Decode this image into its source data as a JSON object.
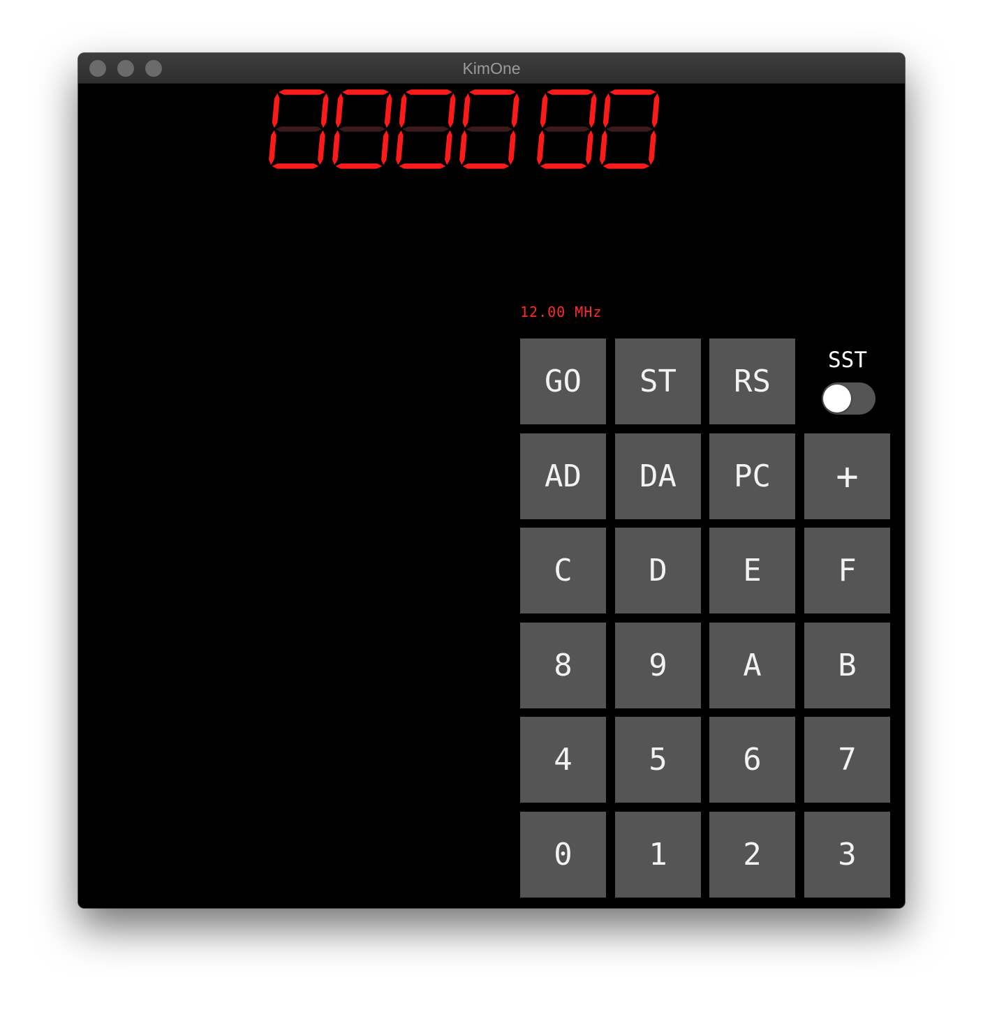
{
  "window": {
    "title": "KimOne"
  },
  "display": {
    "digit_count": 6,
    "lit_color": "#ff1a1a",
    "unlit_color": "#3a1a1a"
  },
  "status": {
    "clock_speed": "12.00 MHz"
  },
  "keypad": {
    "go": "GO",
    "st": "ST",
    "rs": "RS",
    "ad": "AD",
    "da": "DA",
    "pc": "PC",
    "plus": "+",
    "c": "C",
    "d": "D",
    "e": "E",
    "f": "F",
    "k8": "8",
    "k9": "9",
    "a": "A",
    "b": "B",
    "k4": "4",
    "k5": "5",
    "k6": "6",
    "k7": "7",
    "k0": "0",
    "k1": "1",
    "k2": "2",
    "k3": "3"
  },
  "sst": {
    "label": "SST",
    "enabled": false
  },
  "colors": {
    "key_bg": "#555555",
    "key_text": "#f2f2f2",
    "led_red": "#ff1a1a"
  }
}
